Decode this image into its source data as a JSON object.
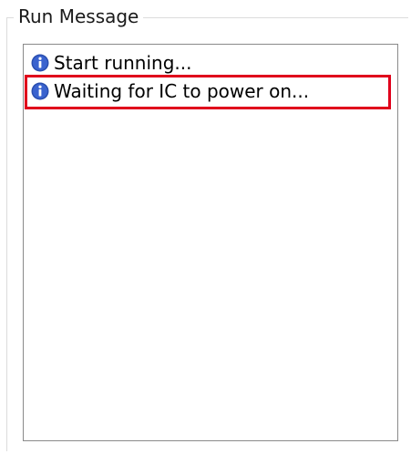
{
  "group": {
    "title": "Run Message"
  },
  "messages": [
    {
      "icon": "info-icon",
      "text": "Start running..."
    },
    {
      "icon": "info-icon",
      "text": "Waiting for IC to power on..."
    }
  ],
  "colors": {
    "info_icon": "#2a4fb0",
    "highlight_border": "#e0001b",
    "list_border": "#8a8a8a"
  }
}
